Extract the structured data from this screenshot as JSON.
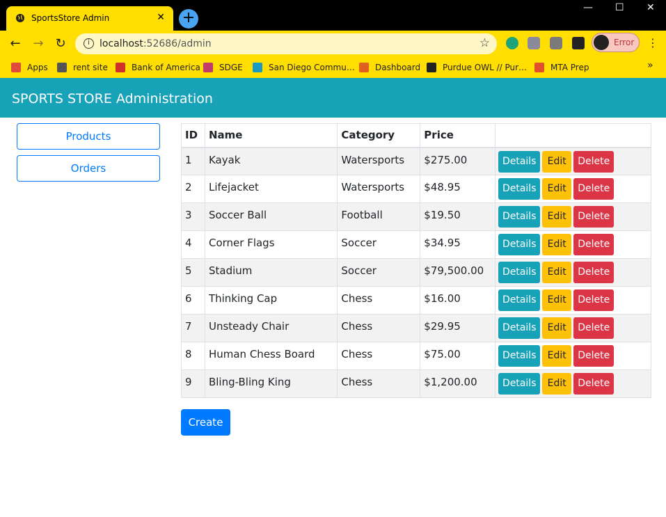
{
  "browser": {
    "tab_title": "SportsStore Admin",
    "tab_close": "✕",
    "new_tab": "+",
    "url_host": "localhost",
    "url_rest": ":52686/admin",
    "profile_status": "Error",
    "bookmarks": [
      {
        "label": "Apps",
        "color": "#e04a3a"
      },
      {
        "label": "rent site",
        "color": "#555555"
      },
      {
        "label": "Bank of America",
        "color": "#d0302a"
      },
      {
        "label": "SDGE",
        "color": "#c23a6a"
      },
      {
        "label": "San Diego Commu…",
        "color": "#1a9ac0"
      },
      {
        "label": "Dashboard",
        "color": "#e06020"
      },
      {
        "label": "Purdue OWL // Pur…",
        "color": "#222222"
      },
      {
        "label": "MTA Prep",
        "color": "#e0502a"
      }
    ],
    "bookmarks_more": "»"
  },
  "header": {
    "title": "SPORTS STORE Administration"
  },
  "sidebar": {
    "products_label": "Products",
    "orders_label": "Orders"
  },
  "table": {
    "headers": [
      "ID",
      "Name",
      "Category",
      "Price",
      ""
    ],
    "rows": [
      {
        "id": "1",
        "name": "Kayak",
        "category": "Watersports",
        "price": "$275.00"
      },
      {
        "id": "2",
        "name": "Lifejacket",
        "category": "Watersports",
        "price": "$48.95"
      },
      {
        "id": "3",
        "name": "Soccer Ball",
        "category": "Football",
        "price": "$19.50"
      },
      {
        "id": "4",
        "name": "Corner Flags",
        "category": "Soccer",
        "price": "$34.95"
      },
      {
        "id": "5",
        "name": "Stadium",
        "category": "Soccer",
        "price": "$79,500.00"
      },
      {
        "id": "6",
        "name": "Thinking Cap",
        "category": "Chess",
        "price": "$16.00"
      },
      {
        "id": "7",
        "name": "Unsteady Chair",
        "category": "Chess",
        "price": "$29.95"
      },
      {
        "id": "8",
        "name": "Human Chess Board",
        "category": "Chess",
        "price": "$75.00"
      },
      {
        "id": "9",
        "name": "Bling-Bling King",
        "category": "Chess",
        "price": "$1,200.00"
      }
    ],
    "details_label": "Details",
    "edit_label": "Edit",
    "delete_label": "Delete"
  },
  "create_label": "Create",
  "colors": {
    "chrome_yellow": "#ffde00",
    "header_teal": "#17a2b8",
    "primary": "#007bff",
    "warning": "#ffc107",
    "danger": "#dc3545"
  }
}
